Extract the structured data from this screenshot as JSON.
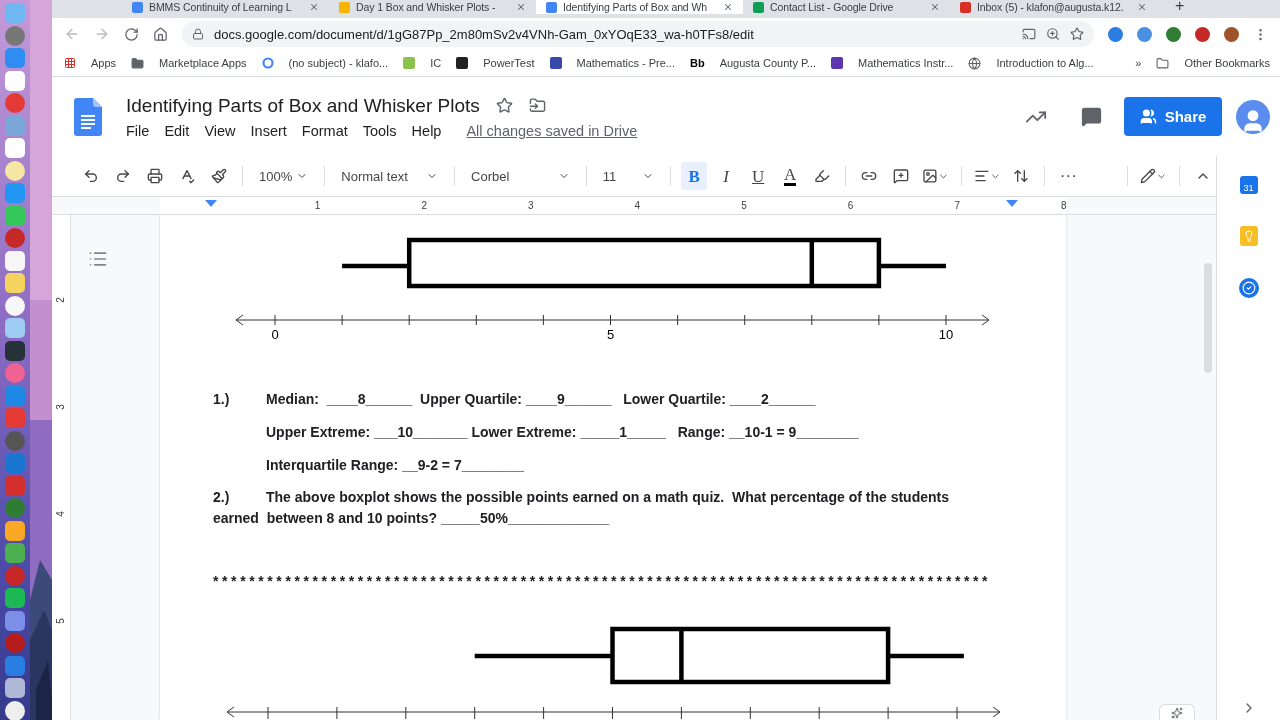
{
  "browser": {
    "tabs": [
      {
        "title": "BMMS Continuity of Learning L",
        "selected": false,
        "color": "#4285f4"
      },
      {
        "title": "Day 1 Box and Whisker Plots - ",
        "selected": false,
        "color": "#f4b400"
      },
      {
        "title": "Identifying Parts of Box and Wh",
        "selected": true,
        "color": "#4285f4"
      },
      {
        "title": "Contact List - Google Drive",
        "selected": false,
        "color": "#0f9d58"
      },
      {
        "title": "Inbox (5) - klafon@augusta.k12.",
        "selected": false,
        "color": "#d93025"
      }
    ],
    "new_tab": "+",
    "url": "docs.google.com/document/d/1gG87Pp_2m80mSv2v4VNh-Gam_0xYOqE33_wa-h0TFs8/edit",
    "bookmarks": [
      {
        "label": "Apps",
        "kind": "apps"
      },
      {
        "label": "Marketplace Apps",
        "kind": "folder"
      },
      {
        "label": "(no subject) - klafo...",
        "kind": "google"
      },
      {
        "label": "IC",
        "kind": "square",
        "color": "#8bc34a"
      },
      {
        "label": "PowerTest",
        "kind": "square",
        "color": "#222222"
      },
      {
        "label": "Mathematics - Pre...",
        "kind": "square",
        "color": "#3949ab"
      },
      {
        "label": "Augusta County P...",
        "kind": "text",
        "icon_text": "Bb"
      },
      {
        "label": "Mathematics Instr...",
        "kind": "square",
        "color": "#5e35b1"
      },
      {
        "label": "Introduction to Alg...",
        "kind": "globe"
      }
    ],
    "bookmarks_overflow": "»",
    "other_bookmarks": "Other Bookmarks"
  },
  "docs": {
    "title": "Identifying Parts of Box and Whisker Plots",
    "menu": [
      "File",
      "Edit",
      "View",
      "Insert",
      "Format",
      "Tools",
      "Help"
    ],
    "save_status": "All changes saved in Drive",
    "share": "Share"
  },
  "toolbar": {
    "zoom": "100%",
    "style": "Normal text",
    "font": "Corbel",
    "size": "11",
    "format": [
      {
        "label": "B",
        "kind": "bold",
        "on": true
      },
      {
        "label": "I",
        "kind": "italic",
        "on": false
      },
      {
        "label": "U",
        "kind": "underline",
        "on": false
      },
      {
        "label": "A",
        "kind": "color",
        "on": false
      }
    ],
    "more": "···"
  },
  "ruler": [
    "1",
    "2",
    "3",
    "4",
    "5",
    "6",
    "7",
    "8"
  ],
  "vertical_ruler": [
    "2",
    "3",
    "4",
    "5"
  ],
  "side_panel": {
    "calendar_day": "31"
  },
  "page": {
    "plot_labels": [
      "0",
      "5",
      "10"
    ],
    "question_1": {
      "number": "1.)",
      "lines": [
        "Median:  ____8______  Upper Quartile: ____9______   Lower Quartile: ____2______",
        "Upper Extreme: ___10_______ Lower Extreme: _____1_____   Range: __10-1 = 9________",
        "Interquartile Range: __9-2 = 7________"
      ]
    },
    "question_2": {
      "number": "2.)",
      "text": "The above boxplot shows the possible points earned on a math quiz.  What percentage of the students earned  between 8 and 10 points? _____50%_____________"
    },
    "separator": "**************************************************************************************"
  }
}
